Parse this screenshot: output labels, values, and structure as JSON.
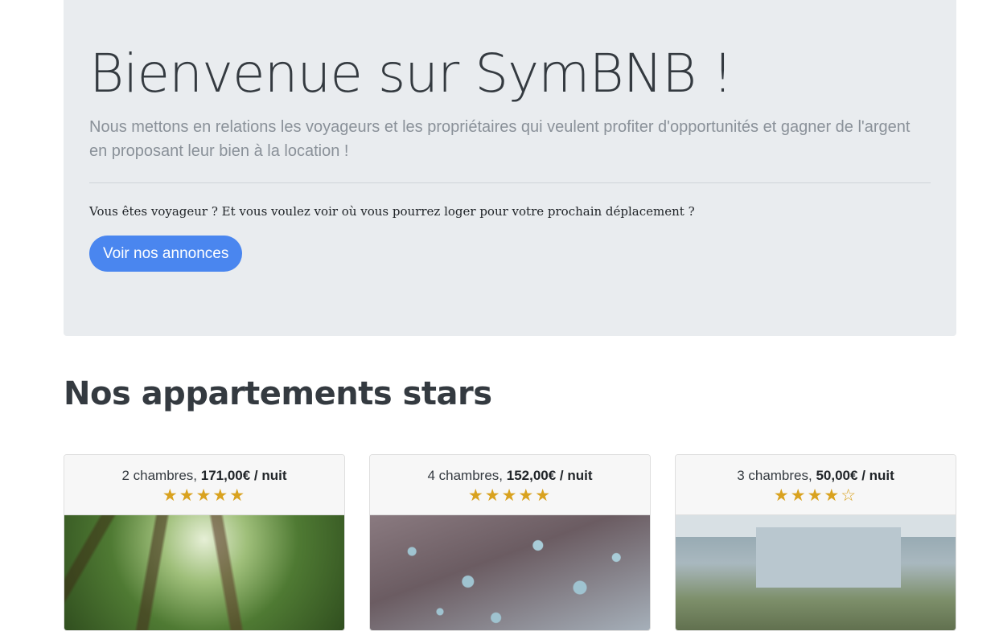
{
  "hero": {
    "title": "Bienvenue sur SymBNB !",
    "lead": "Nous mettons en relations les voyageurs et les propriétaires qui veulent profiter d'opportunités et gagner de l'argent en proposant leur bien à la location !",
    "question": "Vous êtes voyageur ? Et vous voulez voir où vous pourrez loger pour votre prochain déplacement ?",
    "button_label": "Voir nos annonces"
  },
  "section": {
    "title": "Nos appartements stars"
  },
  "cards": [
    {
      "rooms": "2 chambres,",
      "price": "171,00€ / nuit",
      "rating": 5,
      "max_rating": 5,
      "image": "forest"
    },
    {
      "rooms": "4 chambres,",
      "price": "152,00€ / nuit",
      "rating": 5,
      "max_rating": 5,
      "image": "water-drops"
    },
    {
      "rooms": "3 chambres,",
      "price": "50,00€ / nuit",
      "rating": 4,
      "max_rating": 5,
      "image": "vintage-van"
    }
  ],
  "colors": {
    "jumbotron_bg": "#e9ecef",
    "primary_button": "#4a86ef",
    "star": "#d9a21f"
  }
}
